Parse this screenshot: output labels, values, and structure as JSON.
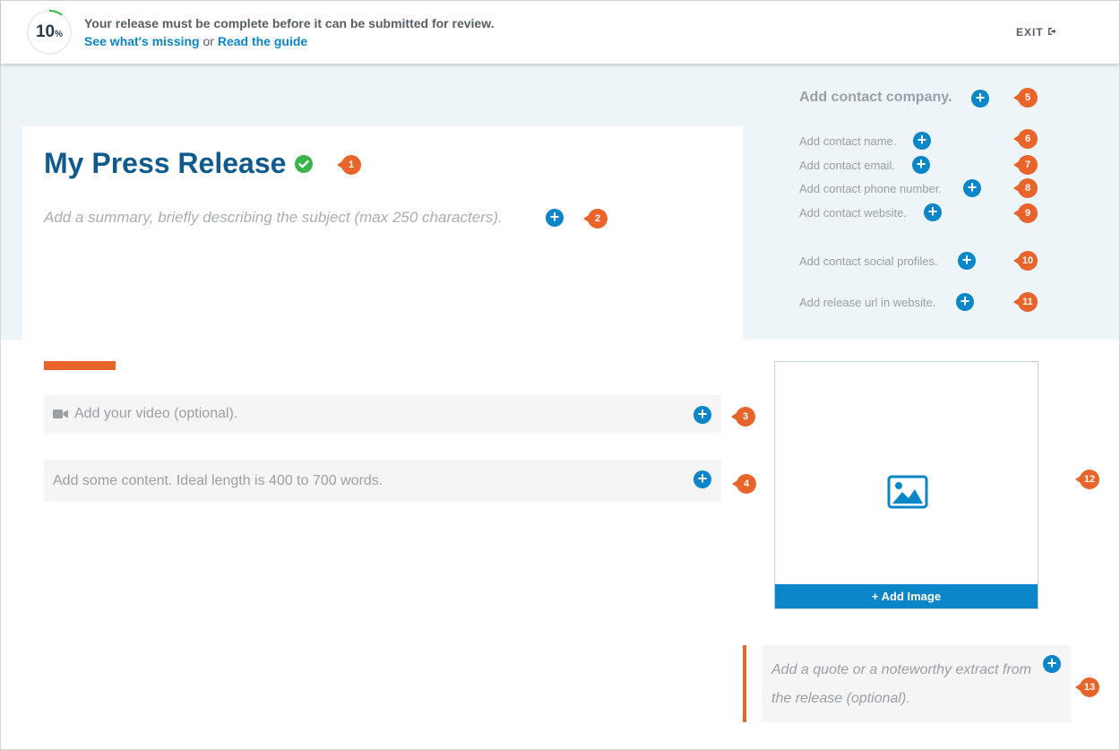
{
  "colors": {
    "accent_blue": "#0a86c9",
    "title_blue": "#0f5b8e",
    "marker_orange": "#e8642a",
    "check_green": "#3ab54a",
    "band_bg": "#eef5f9"
  },
  "progress": {
    "value": "10",
    "unit": "%",
    "fraction": 0.1
  },
  "topbar": {
    "message": "Your release must be complete before it can be submitted for review.",
    "link_missing": "See what's missing",
    "link_separator": " or ",
    "link_guide": "Read the guide",
    "exit_label": "EXIT",
    "exit_icon": "sign-out-icon"
  },
  "release": {
    "title": "My Press Release",
    "title_status_icon": "check-circle-icon",
    "summary_placeholder": "Add a summary, briefly describing the subject (max 250 characters)."
  },
  "contact": {
    "company": "Add contact company.",
    "items": [
      "Add contact name.",
      "Add contact email.",
      "Add contact phone number.",
      "Add contact website.",
      "Add contact social profiles.",
      "Add release url in website."
    ]
  },
  "body": {
    "video_placeholder": "Add your video (optional).",
    "video_icon": "video-camera-icon",
    "content_placeholder": "Add some content. Ideal length is 400 to 700 words.",
    "image_icon": "image-icon",
    "add_image_label": "+ Add Image",
    "quote_placeholder": "Add a quote or a noteworthy extract from the release (optional)."
  },
  "markers": [
    "1",
    "2",
    "3",
    "4",
    "5",
    "6",
    "7",
    "8",
    "9",
    "10",
    "11",
    "12",
    "13"
  ]
}
